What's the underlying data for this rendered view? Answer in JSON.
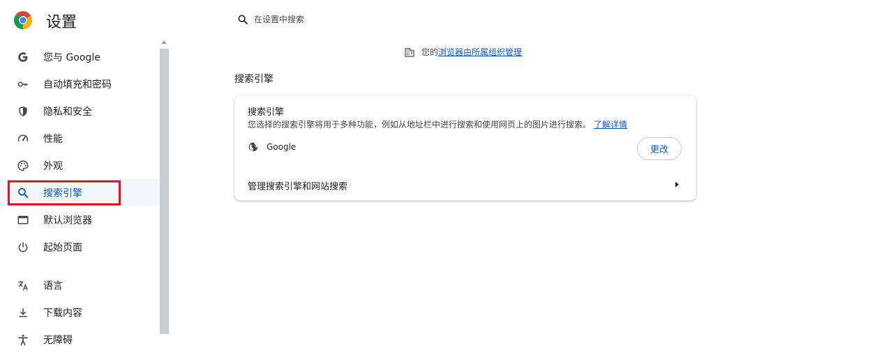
{
  "header": {
    "logo_icon": "chrome-logo-icon",
    "title": "设置",
    "search": {
      "icon": "search-icon",
      "placeholder": "在设置中搜索"
    }
  },
  "sidebar": {
    "items": [
      {
        "label": "您与 Google",
        "icon": "google-g-icon"
      },
      {
        "label": "自动填充和密码",
        "icon": "key-icon"
      },
      {
        "label": "隐私和安全",
        "icon": "shield-icon"
      },
      {
        "label": "性能",
        "icon": "speedometer-icon"
      },
      {
        "label": "外观",
        "icon": "palette-icon"
      },
      {
        "label": "搜索引擎",
        "icon": "search-icon",
        "active": true
      },
      {
        "label": "默认浏览器",
        "icon": "browser-window-icon"
      },
      {
        "label": "起始页面",
        "icon": "power-icon"
      },
      {
        "label": "语言",
        "icon": "translate-icon"
      },
      {
        "label": "下载内容",
        "icon": "download-icon"
      },
      {
        "label": "无障碍",
        "icon": "accessibility-icon"
      }
    ]
  },
  "managed_notice": {
    "icon": "building-icon",
    "prefix": "您的",
    "link": "浏览器由所属组织管理"
  },
  "main": {
    "section_title": "搜索引擎",
    "card": {
      "title": "搜索引擎",
      "description": "您选择的搜索引擎将用于多种功能，例如从地址栏中进行搜索和使用网页上的图片进行搜索。",
      "learn_more": "了解详情",
      "engine": {
        "icon": "globe-icon",
        "name": "Google"
      },
      "change_label": "更改",
      "manage_label": "管理搜索引擎和网站搜索"
    }
  },
  "colors": {
    "accent": "#0b57d0",
    "active_bg": "#f3f6fc",
    "highlight_box": "#e8141c",
    "text": "#1f1f1f",
    "secondary_text": "#474747"
  }
}
